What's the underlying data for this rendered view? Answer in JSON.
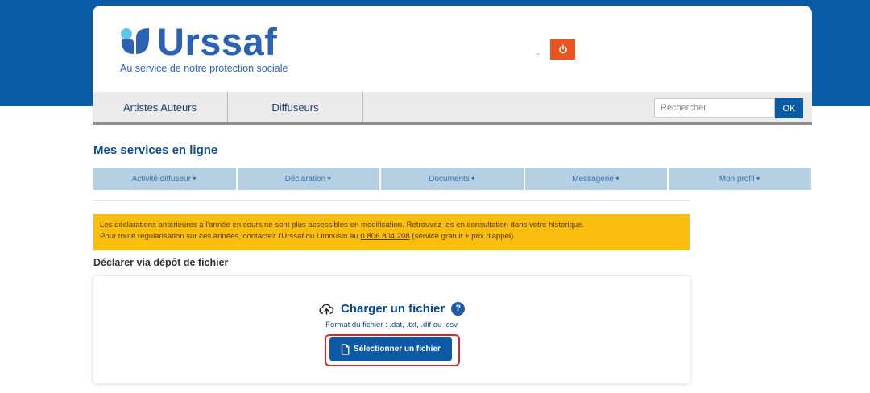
{
  "brand": {
    "name": "Urssaf",
    "tagline": "Au service de notre protection sociale"
  },
  "header": {
    "power_icon": "power-icon"
  },
  "nav": {
    "tabs": [
      {
        "label": "Artistes Auteurs"
      },
      {
        "label": "Diffuseurs"
      }
    ],
    "search": {
      "placeholder": "Rechercher",
      "value": ""
    },
    "ok_label": "OK"
  },
  "services": {
    "title": "Mes services en ligne",
    "menu": [
      {
        "label": "Activité diffuseur"
      },
      {
        "label": "Déclaration"
      },
      {
        "label": "Documents"
      },
      {
        "label": "Messagerie"
      },
      {
        "label": "Mon profil"
      }
    ]
  },
  "alert": {
    "line1": "Les déclarations antérieures à l'année en cours ne sont plus accessibles en modification. Retrouvez-les en consultation dans votre historique.",
    "line2_prefix": "Pour toute régularisation sur ces années, contactez l'Urssaf du Limousin au ",
    "phone": "0 806 804 208",
    "line2_suffix": " (service gratuit + prix d'appel)."
  },
  "deposit": {
    "title": "Déclarer via dépôt de fichier",
    "upload_title": "Charger un fichier",
    "help_label": "?",
    "format_text": "Format du fichier : .dat, .txt, .dif ou .csv",
    "select_button": "Sélectionner un fichier"
  },
  "colors": {
    "brand_blue": "#0a5ba6",
    "alert_yellow": "#fbbd10",
    "power_orange": "#e8561e",
    "highlight_red": "#d9262c"
  }
}
